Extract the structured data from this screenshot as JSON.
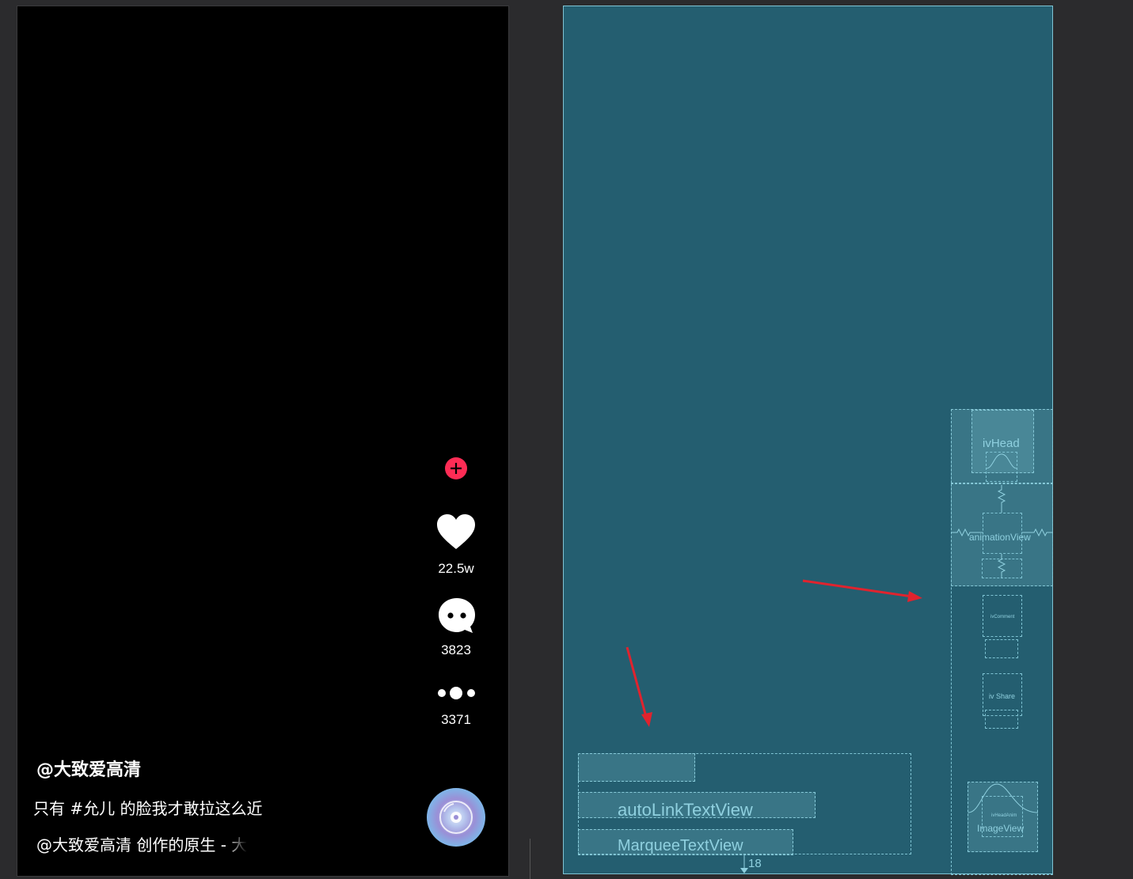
{
  "design": {
    "actions": {
      "follow_icon": "plus-icon",
      "like_count": "22.5w",
      "comment_count": "3823",
      "share_count": "3371"
    },
    "author": "@大致爱高清",
    "caption": "只有 #允儿 的脸我才敢拉这么近",
    "music": "@大致爱高清 创作的原生 - 大"
  },
  "blueprint": {
    "labels": {
      "head": "ivHead",
      "animation": "animationView",
      "comment": "ivComment",
      "share": "iv Share",
      "head_anim": "ivHeadAnim",
      "image_view": "ImageView",
      "auto_link": "autoLinkTextView",
      "marquee": "MarqueeTextView",
      "margin": "18"
    }
  },
  "colors": {
    "follow_badge": "#fe2c55",
    "blueprint_bg": "#245e70",
    "blueprint_line": "#7ec3d3",
    "arrow": "#e0232e"
  }
}
